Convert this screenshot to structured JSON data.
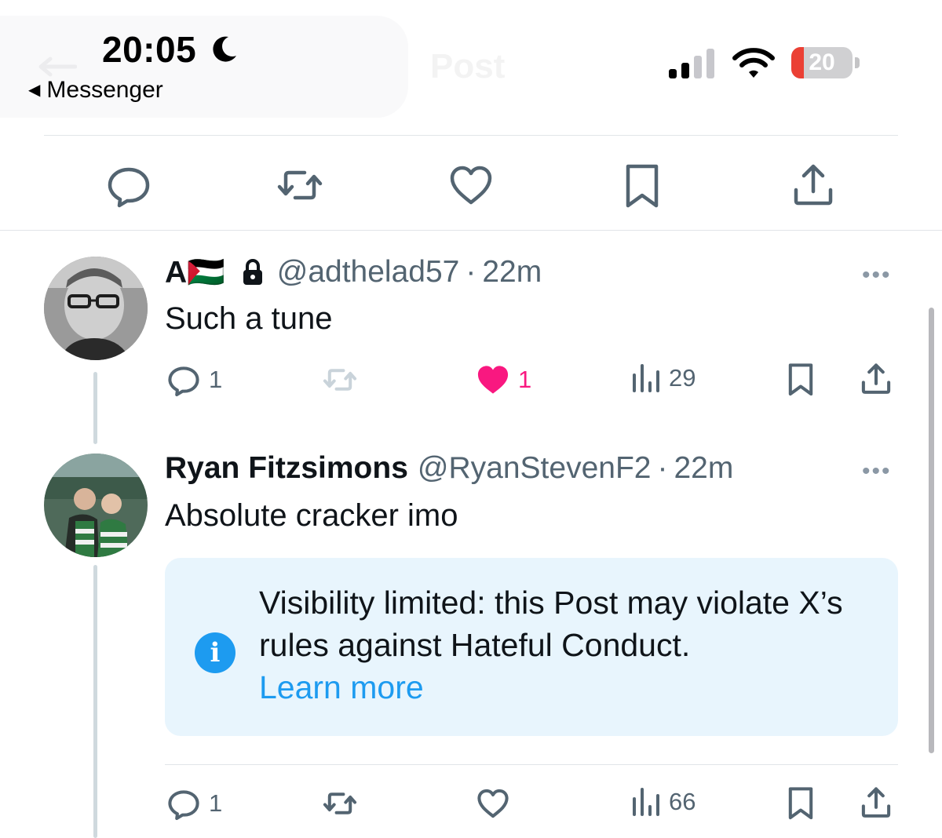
{
  "status_bar": {
    "time": "20:05",
    "back_app": "Messenger",
    "battery_percent": "20",
    "battery_level": 0.2,
    "ghost_title": "Post"
  },
  "main_actions": [
    "reply-icon",
    "repost-icon",
    "like-icon",
    "bookmark-icon",
    "share-icon"
  ],
  "replies": [
    {
      "name": "A🇵🇸",
      "handle": "@adthelad57",
      "separator": "·",
      "time": "22m",
      "text": "Such a tune",
      "protected": true,
      "replies_count": "1",
      "likes_count": "1",
      "views_count": "29",
      "liked": true
    },
    {
      "name": "Ryan Fitzsimons",
      "handle": "@RyanStevenF2",
      "separator": "·",
      "time": "22m",
      "text": "Absolute cracker imo",
      "replies_count": "1",
      "views_count": "66",
      "liked": false,
      "notice": {
        "text": "Visibility limited: this Post may violate X’s rules against Hateful Conduct.",
        "link": "Learn more"
      }
    }
  ],
  "more_label": "•••",
  "colors": {
    "accent": "#1d9bf0",
    "like": "#f91880",
    "secondary_text": "#536471",
    "notice_bg": "#e8f5fd"
  }
}
